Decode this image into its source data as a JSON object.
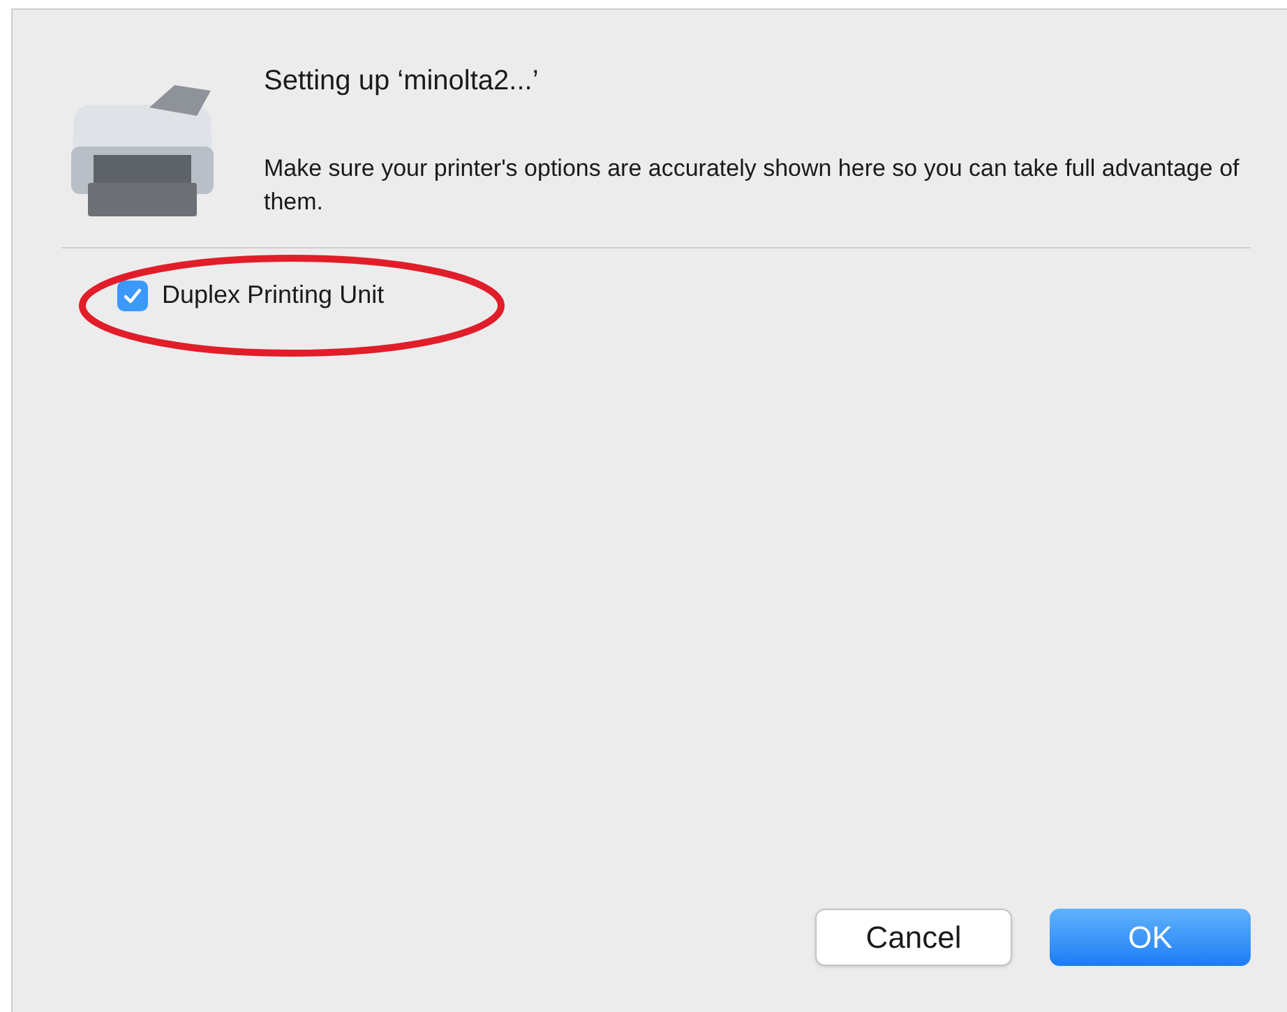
{
  "dialog": {
    "title": "Setting up ‘minolta2...’",
    "message": "Make sure your printer's options are accurately shown here so you can take full advantage of them."
  },
  "options": [
    {
      "label": "Duplex Printing Unit",
      "checked": true
    }
  ],
  "buttons": [
    {
      "label": "Cancel",
      "kind": "secondary"
    },
    {
      "label": "OK",
      "kind": "default"
    }
  ]
}
